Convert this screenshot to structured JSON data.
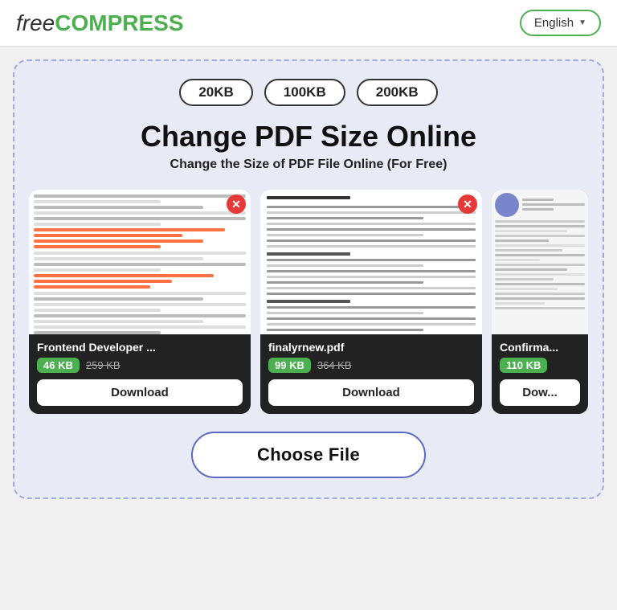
{
  "header": {
    "logo_free": "free",
    "logo_compress": "COMPRESS",
    "lang_label": "English",
    "lang_chevron": "▼"
  },
  "size_badges": [
    "20KB",
    "100KB",
    "200KB"
  ],
  "main_title": "Change PDF Size Online",
  "sub_title": "Change the Size of PDF File Online (For Free)",
  "files": [
    {
      "name": "Frontend Developer ...",
      "size_new": "46 KB",
      "size_old": "259 KB",
      "download_label": "Download"
    },
    {
      "name": "finalyrnew.pdf",
      "size_new": "99 KB",
      "size_old": "364 KB",
      "download_label": "Download"
    },
    {
      "name": "Confirma...",
      "size_new": "110 KB",
      "size_old": "",
      "download_label": "Dow..."
    }
  ],
  "choose_file_label": "Choose File"
}
